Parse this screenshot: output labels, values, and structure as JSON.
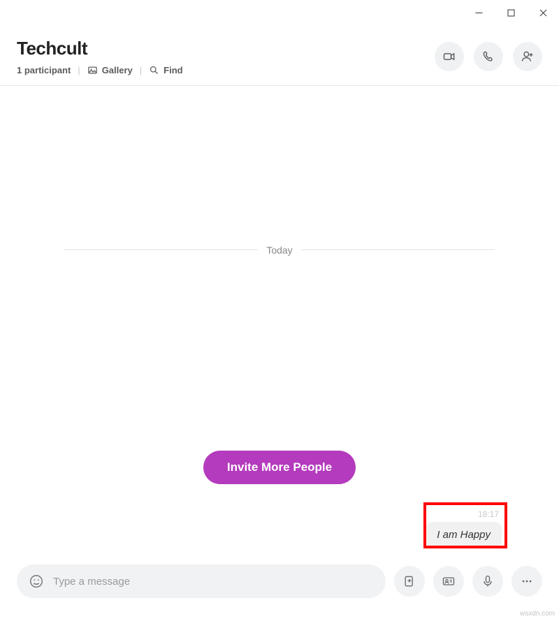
{
  "chat": {
    "title": "Techcult",
    "participants_text": "1 participant",
    "gallery_label": "Gallery",
    "find_label": "Find",
    "date_label": "Today",
    "invite_label": "Invite More People",
    "message": {
      "time": "18:17",
      "text": "I am Happy"
    }
  },
  "composer": {
    "placeholder": "Type a message"
  },
  "watermark": "wsxdn.com"
}
